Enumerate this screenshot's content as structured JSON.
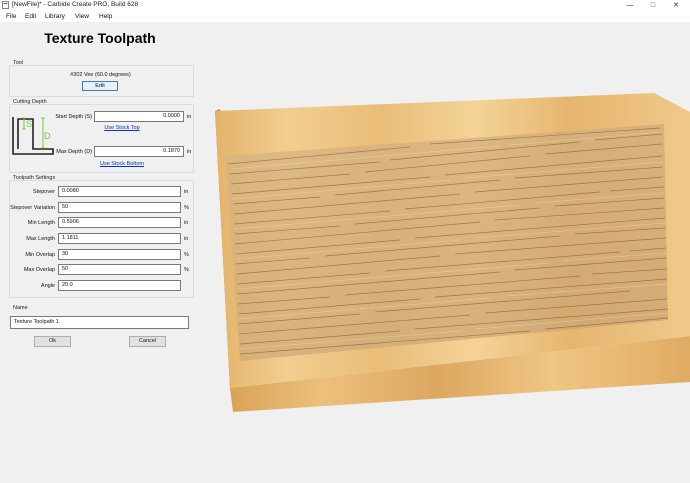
{
  "window": {
    "title": "[NewFile]* - Carbide Create PRO, Build 628",
    "minimize_icon": "minimize-icon",
    "maximize_icon": "maximize-icon",
    "close_icon": "close-icon"
  },
  "menu": [
    "File",
    "Edit",
    "Library",
    "View",
    "Help"
  ],
  "panel": {
    "heading": "Texture Toolpath",
    "tool": {
      "label": "Tool",
      "name": "#302 Vee (60.0 degrees)",
      "edit_label": "Edit"
    },
    "cutting_depth": {
      "label": "Cutting Depth",
      "start_label": "Start Depth (S)",
      "start_value": "0.0000",
      "start_unit": "in",
      "use_stock_top": "Use Stock Top",
      "max_label": "Max Depth (D)",
      "max_value": "0.1870",
      "max_unit": "in",
      "use_stock_bottom": "Use Stock Bottom",
      "diagram_s": "S",
      "diagram_d": "D"
    },
    "toolpath_settings": {
      "label": "Toolpath Settings",
      "rows": [
        {
          "label": "Stepover",
          "value": "0.0080",
          "unit": "in"
        },
        {
          "label": "Stepover Variation",
          "value": "50",
          "unit": "%"
        },
        {
          "label": "Min Length",
          "value": "0.5906",
          "unit": "in"
        },
        {
          "label": "Max Length",
          "value": "1.1811",
          "unit": "in"
        },
        {
          "label": "Min Overlap",
          "value": "30",
          "unit": "%"
        },
        {
          "label": "Max Overlap",
          "value": "50",
          "unit": "%"
        },
        {
          "label": "Angle",
          "value": "20.0",
          "unit": ""
        }
      ]
    },
    "name": {
      "label": "Name",
      "value": "Texture Toolpath 1"
    },
    "ok_label": "Ok",
    "cancel_label": "Cancel"
  },
  "colors": {
    "link": "#0033cc",
    "wood_light": "#f0c98a",
    "wood_dark": "#c98f45",
    "diagram_green": "#7ac943"
  }
}
